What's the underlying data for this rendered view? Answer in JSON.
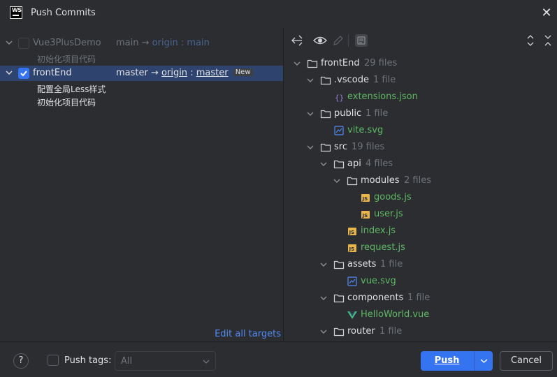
{
  "window": {
    "title": "Push Commits",
    "logo_text": "WS"
  },
  "repos": [
    {
      "name": "Vue3PlusDemo",
      "checked": false,
      "local_branch": "main",
      "arrow": "→",
      "remote": "origin",
      "separator": ":",
      "remote_branch": "main",
      "badge": "",
      "commits": [
        "初始化项目代码"
      ]
    },
    {
      "name": "frontEnd",
      "checked": true,
      "local_branch": "master",
      "arrow": "→",
      "remote": "origin",
      "separator": ":",
      "remote_branch": "master",
      "badge": "New",
      "commits": [
        "配置全局Less样式",
        "初始化项目代码"
      ]
    }
  ],
  "edit_targets_label": "Edit all targets",
  "tree": [
    {
      "label": "frontEnd",
      "count": "29 files",
      "type": "folder"
    },
    {
      "label": ".vscode",
      "count": "1 file",
      "type": "folder"
    },
    {
      "label": "extensions.json",
      "count": "",
      "type": "json"
    },
    {
      "label": "public",
      "count": "1 file",
      "type": "folder"
    },
    {
      "label": "vite.svg",
      "count": "",
      "type": "svg"
    },
    {
      "label": "src",
      "count": "19 files",
      "type": "folder"
    },
    {
      "label": "api",
      "count": "4 files",
      "type": "folder"
    },
    {
      "label": "modules",
      "count": "2 files",
      "type": "folder"
    },
    {
      "label": "goods.js",
      "count": "",
      "type": "js"
    },
    {
      "label": "user.js",
      "count": "",
      "type": "js"
    },
    {
      "label": "index.js",
      "count": "",
      "type": "js"
    },
    {
      "label": "request.js",
      "count": "",
      "type": "js"
    },
    {
      "label": "assets",
      "count": "1 file",
      "type": "folder"
    },
    {
      "label": "vue.svg",
      "count": "",
      "type": "svg"
    },
    {
      "label": "components",
      "count": "1 file",
      "type": "folder"
    },
    {
      "label": "HelloWorld.vue",
      "count": "",
      "type": "vue"
    },
    {
      "label": "router",
      "count": "1 file",
      "type": "folder"
    }
  ],
  "footer": {
    "help": "?",
    "push_tags_label": "Push tags:",
    "tags_select_value": "All",
    "push_label": "Push",
    "cancel_label": "Cancel"
  },
  "colors": {
    "accent": "#3574f0",
    "selection": "#2e436e",
    "link": "#548af7",
    "modified_file": "#5fb865"
  }
}
